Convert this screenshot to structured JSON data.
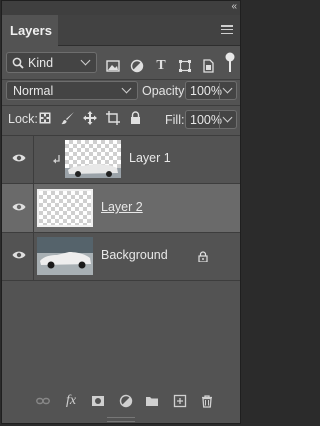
{
  "panel": {
    "tab_label": "Layers",
    "collapse_glyph": "«"
  },
  "filter": {
    "kind_label": "Kind",
    "icons": [
      "image-filter-icon",
      "adjustment-filter-icon",
      "type-filter-icon",
      "shape-filter-icon",
      "smart-object-filter-icon",
      "filter-toggle-icon"
    ]
  },
  "blend": {
    "mode": "Normal",
    "opacity_label": "Opacity:",
    "opacity_value": "100%"
  },
  "lock": {
    "label": "Lock:",
    "fill_label": "Fill:",
    "fill_value": "100%"
  },
  "layers": [
    {
      "name": "Layer 1",
      "clipped": true,
      "selected": false,
      "visible": true
    },
    {
      "name": "Layer 2",
      "clipped": false,
      "selected": true,
      "visible": true
    },
    {
      "name": "Background",
      "clipped": false,
      "selected": false,
      "visible": true,
      "locked": true
    }
  ],
  "footer_icons": [
    "link-layers-icon",
    "fx-icon",
    "add-mask-icon",
    "new-adjustment-icon",
    "new-group-icon",
    "new-layer-icon",
    "delete-layer-icon"
  ],
  "footer_fx": "fx"
}
